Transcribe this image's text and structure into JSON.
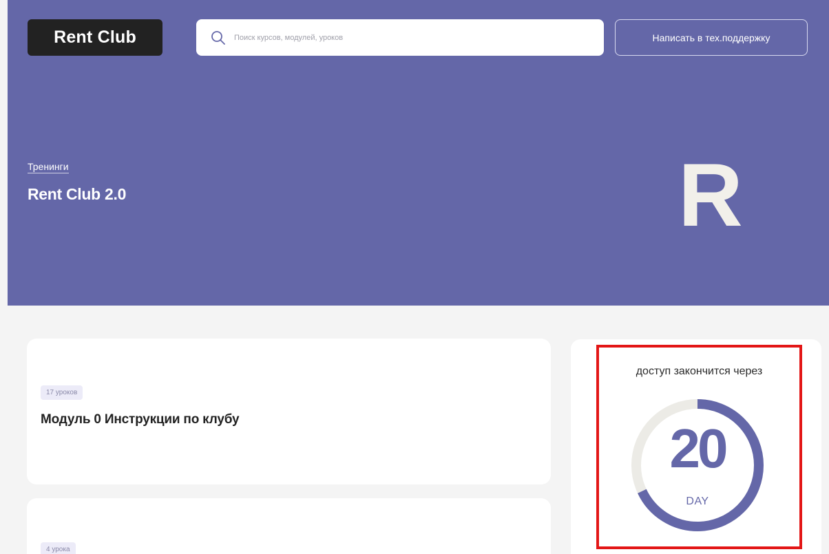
{
  "header": {
    "logo_text": "Rent Club",
    "search": {
      "placeholder": "Поиск курсов, модулей, уроков",
      "icon": "search-icon"
    },
    "support_button_label": "Написать в тех.поддержку"
  },
  "hero": {
    "breadcrumb": "Тренинги",
    "title": "Rent Club 2.0",
    "brand_mark": "R"
  },
  "modules": [
    {
      "lessons_badge": "17 уроков",
      "title": "Модуль 0  Инструкции по клубу"
    },
    {
      "lessons_badge": "4 урока",
      "title": ""
    }
  ],
  "access": {
    "label": "доступ закончится через",
    "days_value": "20",
    "days_unit": "DAY",
    "progress_fraction": 0.68
  },
  "colors": {
    "hero_background": "#6467a8",
    "accent": "#6467a8",
    "ring_track": "#ecebe6",
    "highlight": "#e31616",
    "page_background": "#f4f4f4"
  }
}
